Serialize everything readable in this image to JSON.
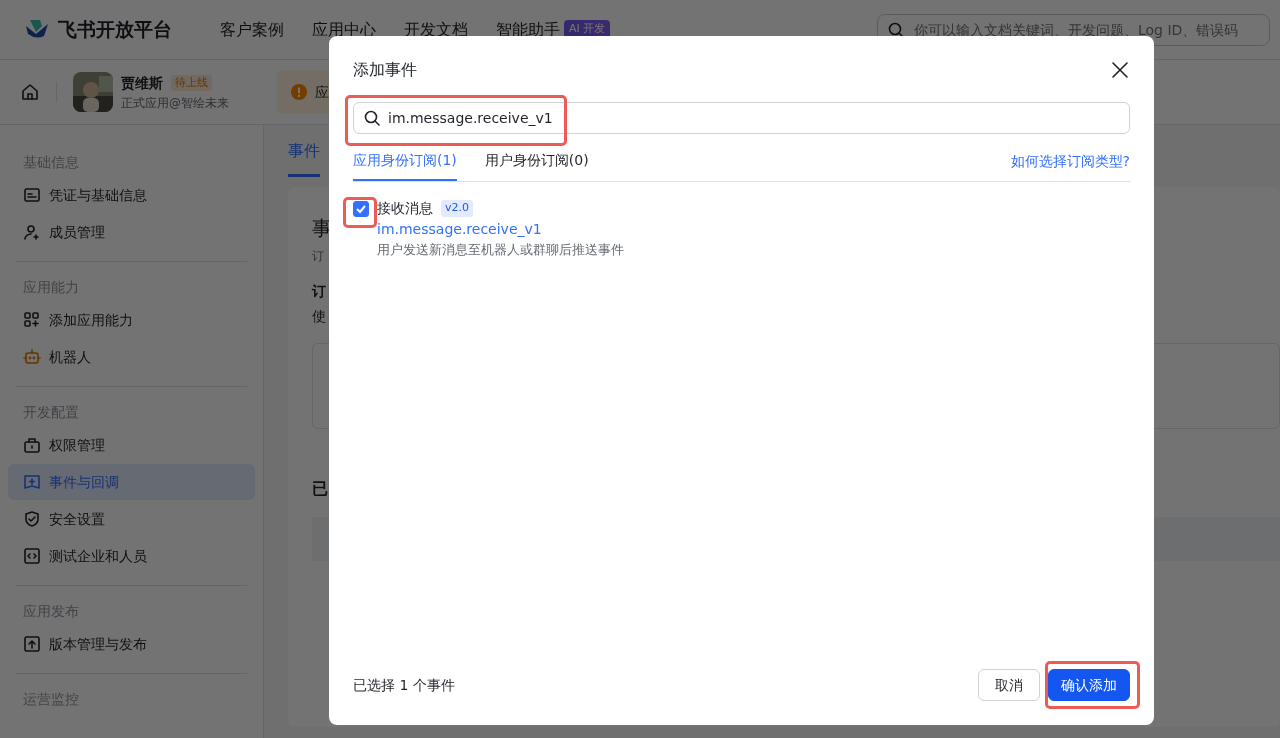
{
  "header": {
    "logo": "飞书开放平台",
    "nav": [
      {
        "label": "客户案例"
      },
      {
        "label": "应用中心"
      },
      {
        "label": "开发文档"
      },
      {
        "label": "智能助手",
        "badge": "AI 开发"
      }
    ],
    "search": {
      "placeholder": "你可以输入文档关键词、开发问题、Log ID、错误码"
    }
  },
  "app_bar": {
    "name": "贾维斯",
    "status": "待上线",
    "subtitle": "正式应用@智绘未来",
    "notice": "应"
  },
  "sidebar": {
    "sections": [
      {
        "title": "基础信息",
        "items": [
          {
            "label": "凭证与基础信息",
            "selected": false
          },
          {
            "label": "成员管理",
            "selected": false
          }
        ]
      },
      {
        "title": "应用能力",
        "items": [
          {
            "label": "添加应用能力",
            "selected": false
          },
          {
            "label": "机器人",
            "selected": false
          }
        ]
      },
      {
        "title": "开发配置",
        "items": [
          {
            "label": "权限管理",
            "selected": false
          },
          {
            "label": "事件与回调",
            "selected": true
          },
          {
            "label": "安全设置",
            "selected": false
          },
          {
            "label": "测试企业和人员",
            "selected": false
          }
        ]
      },
      {
        "title": "应用发布",
        "items": [
          {
            "label": "版本管理与发布",
            "selected": false
          }
        ]
      },
      {
        "title": "运营监控"
      }
    ]
  },
  "main": {
    "tab": "事件",
    "heading": "事",
    "subtitle": "订",
    "section": "订",
    "section_text": "使",
    "added_heading": "已"
  },
  "dialog": {
    "title": "添加事件",
    "search": {
      "value": "im.message.receive_v1",
      "highlighted": true
    },
    "tabs": [
      {
        "label": "应用身份订阅(1)",
        "selected": true
      },
      {
        "label": "用户身份订阅(0)",
        "selected": false
      }
    ],
    "help_link": "如何选择订阅类型?",
    "events": [
      {
        "name": "接收消息",
        "version": "v2.0",
        "key": "im.message.receive_v1",
        "description": "用户发送新消息至机器人或群聊后推送事件",
        "checked": true,
        "highlighted": true
      }
    ],
    "footer": {
      "summary": "已选择 1 个事件",
      "buttons": [
        {
          "label": "取消",
          "kind": "secondary",
          "highlighted": false
        },
        {
          "label": "确认添加",
          "kind": "primary",
          "highlighted": true
        }
      ]
    }
  }
}
